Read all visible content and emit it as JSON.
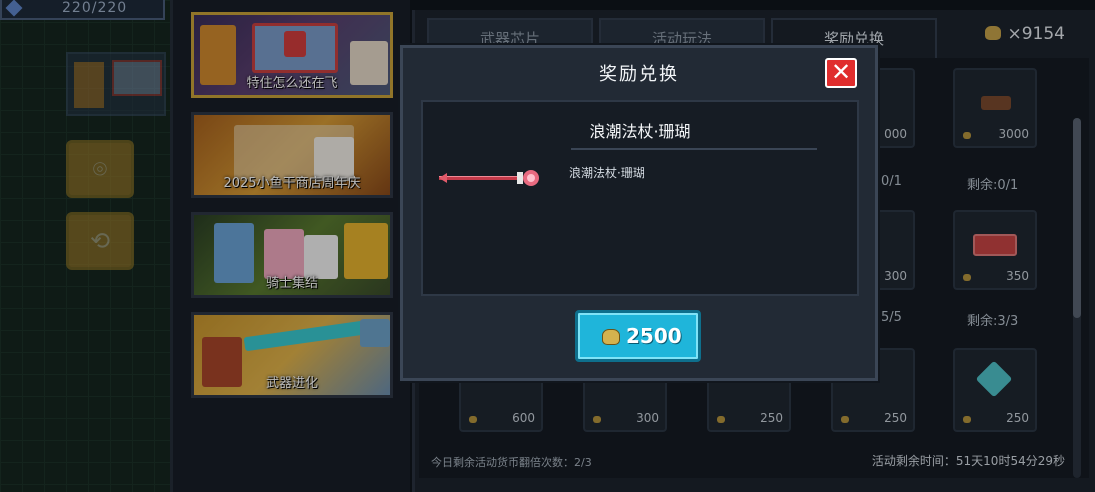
{
  "hud": {
    "hp_text": "220/220"
  },
  "events": [
    {
      "label": "特住怎么还在飞"
    },
    {
      "label": "2025小鱼干商店周年庆"
    },
    {
      "label": "骑士集结"
    },
    {
      "label": "武器进化"
    }
  ],
  "tabs": [
    {
      "label": "武器芯片",
      "active": false
    },
    {
      "label": "活动玩法",
      "active": false
    },
    {
      "label": "奖励兑换",
      "active": true
    }
  ],
  "currency": {
    "amount": "×9154",
    "icon": "bug-coin-icon"
  },
  "shop": {
    "cards_row1": [
      {
        "price": "000"
      },
      {
        "price": "3000"
      }
    ],
    "remain_row1": [
      "0/1",
      "剩余:0/1"
    ],
    "cards_row2": [
      {
        "price": "300"
      },
      {
        "price": "350"
      }
    ],
    "remain_row2": [
      "5/5",
      "剩余:3/3"
    ],
    "cards_row3": [
      {
        "price": "600"
      },
      {
        "price": "300"
      },
      {
        "price": "250"
      },
      {
        "price": "250"
      },
      {
        "price": "250"
      }
    ]
  },
  "footer": {
    "left": "今日剩余活动货币翻倍次数：2/3",
    "right": "活动剩余时间：51天10时54分29秒"
  },
  "modal": {
    "title": "奖励兑换",
    "item_name": "浪潮法杖·珊瑚",
    "item_desc": "浪潮法杖·珊瑚",
    "price": "2500",
    "item_icon": "coral-staff-icon"
  },
  "colors": {
    "accent": "#1fb5da",
    "close": "#e02d2d",
    "active_border": "#c9a23a"
  }
}
